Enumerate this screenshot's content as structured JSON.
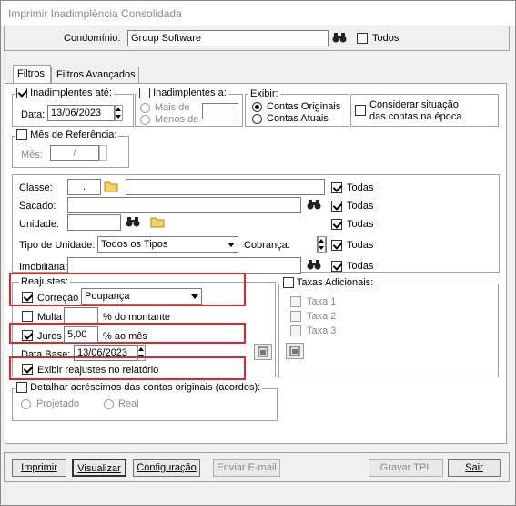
{
  "window": {
    "title": "Imprimir Inadimplência Consolidada"
  },
  "condominio": {
    "label": "Condomínio:",
    "value": "Group Software",
    "todos_label": "Todos"
  },
  "tabs": [
    {
      "label": "Filtros"
    },
    {
      "label": "Filtros Avançados"
    }
  ],
  "inad_ate": {
    "label": "Inadimplentes até:",
    "data_label": "Data:",
    "data_value": "13/06/2023"
  },
  "inad_a": {
    "label": "Inadimplentes a:",
    "mais_de": "Mais de",
    "menos_de": "Menos de"
  },
  "exibir": {
    "label": "Exibir:",
    "opt1": "Contas Originais",
    "opt2": "Contas Atuais"
  },
  "considerar": {
    "line1": "Considerar situação",
    "line2": "das contas na época"
  },
  "mes_ref": {
    "label": "Mês de Referência:",
    "mes_label": "Mês:",
    "mes_value": "/"
  },
  "filters": {
    "classe_label": "Classe:",
    "classe_value": ".",
    "sacado_label": "Sacado:",
    "unidade_label": "Unidade:",
    "tipo_label": "Tipo de Unidade:",
    "tipo_value": "Todos os Tipos",
    "cobranca_label": "Cobrança:",
    "imobiliaria_label": "Imobiliária:",
    "todas": "Todas"
  },
  "reajustes": {
    "label": "Reajustes:",
    "correcao_label": "Correção",
    "correcao_value": "Poupança",
    "multa_label": "Multa",
    "multa_suffix": "% do montante",
    "juros_label": "Juros",
    "juros_value": "5,00",
    "juros_suffix": "% ao mês",
    "data_base_label": "Data Base:",
    "data_base_value": "13/06/2023",
    "exibir_label": "Exibir reajustes no relatório"
  },
  "taxas": {
    "label": "Taxas Adicionais:",
    "t1": "Taxa 1",
    "t2": "Taxa 2",
    "t3": "Taxa 3"
  },
  "detalhar": {
    "label": "Detalhar acréscimos das contas originais (acordos):",
    "opt1": "Projetado",
    "opt2": "Real"
  },
  "buttons": {
    "imprimir": "Imprimir",
    "visualizar": "Visualizar",
    "configuracao": "Configuração",
    "enviar": "Enviar E-mail",
    "gravar": "Gravar TPL",
    "sair": "Sair"
  },
  "colors": {
    "highlight": "#e2242b"
  }
}
